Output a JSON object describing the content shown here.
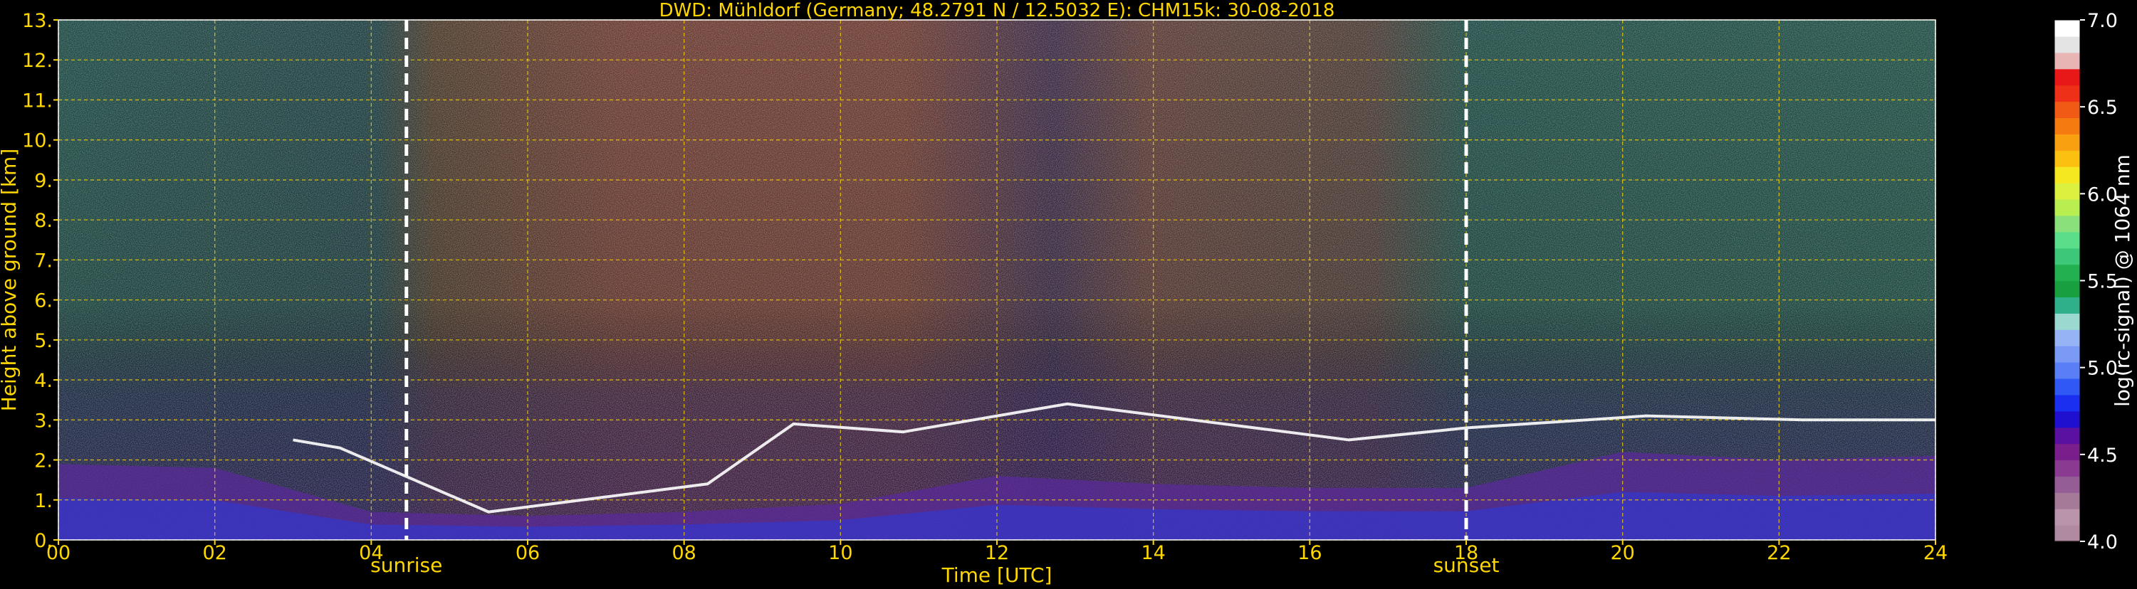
{
  "chart_data": {
    "type": "heatmap",
    "title": "DWD: Mühldorf (Germany; 48.2791 N / 12.5032 E):    CHM15k: 30-08-2018",
    "xlabel": "Time [UTC]",
    "ylabel": "Height above ground [km]",
    "xlim": [
      0,
      24
    ],
    "ylim": [
      0,
      13
    ],
    "x_ticks": [
      "00",
      "02",
      "04",
      "06",
      "08",
      "10",
      "12",
      "14",
      "16",
      "18",
      "20",
      "22",
      "24"
    ],
    "y_ticks": [
      "0.",
      "1.",
      "2.",
      "3.",
      "4.",
      "5.",
      "6.",
      "7.",
      "8.",
      "9.",
      "10.",
      "11.",
      "12.",
      "13."
    ],
    "grid": true,
    "markers": [
      {
        "label": "sunrise",
        "time": 4.45
      },
      {
        "label": "sunset",
        "time": 18.0
      }
    ],
    "colorbar": {
      "label": "log(rc-signal) @ 1064 nm",
      "range": [
        4.0,
        7.0
      ],
      "ticks": [
        "4.0",
        "4.5",
        "5.0",
        "5.5",
        "6.0",
        "6.5",
        "7.0"
      ],
      "levels": [
        "#b08aa0",
        "#b994aa",
        "#a47a98",
        "#955d95",
        "#8a3a90",
        "#7a1e8c",
        "#5a10a0",
        "#1f10d0",
        "#1a2ff0",
        "#2f58f5",
        "#5a7ef5",
        "#7a9af5",
        "#96b4f5",
        "#9ad8d0",
        "#2fb08a",
        "#18a040",
        "#22b050",
        "#3cc878",
        "#5ade8a",
        "#8ae07a",
        "#b8ee50",
        "#dcf040",
        "#f5e820",
        "#fbc010",
        "#f8a010",
        "#f57a10",
        "#f05a14",
        "#ee3018",
        "#e81818",
        "#e8b4b4",
        "#e4e4e4",
        "#ffffff"
      ]
    },
    "features": [
      {
        "name": "aerosol-layer-top",
        "x": [
          0,
          2,
          4,
          6,
          8,
          10,
          12,
          14,
          16,
          18,
          20,
          22,
          24
        ],
        "y": [
          1.9,
          1.8,
          0.7,
          0.6,
          0.7,
          0.9,
          1.6,
          1.4,
          1.3,
          1.3,
          2.2,
          2.0,
          2.1
        ]
      },
      {
        "name": "cloud-layer-base",
        "x": [
          3.0,
          3.6,
          5.5,
          8.3,
          9.4,
          10.8,
          12.9,
          14.5,
          16.5,
          18.0,
          20.3,
          22.3,
          24.0
        ],
        "y": [
          2.5,
          2.3,
          0.7,
          1.4,
          2.9,
          2.7,
          3.4,
          3.0,
          2.5,
          2.8,
          3.1,
          3.0,
          3.0
        ]
      }
    ]
  }
}
